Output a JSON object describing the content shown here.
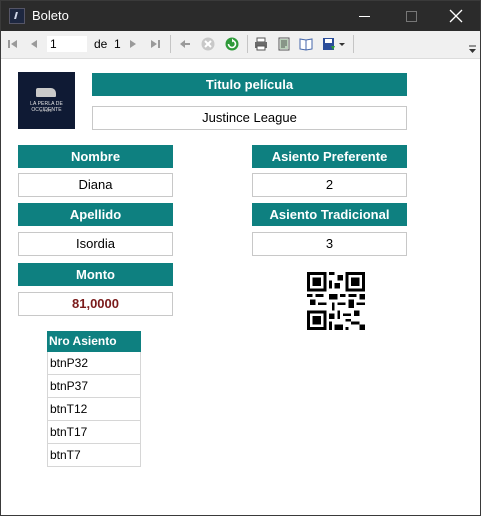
{
  "window": {
    "title": "Boleto"
  },
  "toolbar": {
    "current_page": "1",
    "of_label": "de",
    "total_pages": "1"
  },
  "logo": {
    "name": "LA PERLA DE OCCIDENTE",
    "sub": "CINE"
  },
  "ticket": {
    "movie_header": "Titulo película",
    "movie_value": "Justince League",
    "name_header": "Nombre",
    "name_value": "Diana",
    "lastname_header": "Apellido",
    "lastname_value": "Isordia",
    "amount_header": "Monto",
    "amount_value": "81,0000",
    "preferred_header": "Asiento Preferente",
    "preferred_value": "2",
    "traditional_header": "Asiento Tradicional",
    "traditional_value": "3"
  },
  "seats": {
    "header": "Nro Asiento",
    "rows": [
      "btnP32",
      "btnP37",
      "btnT12",
      "btnT17",
      "btnT7"
    ]
  },
  "colors": {
    "accent": "#0e8080",
    "amount_text": "#7a1a1a",
    "titlebar": "#2b2b2b"
  }
}
